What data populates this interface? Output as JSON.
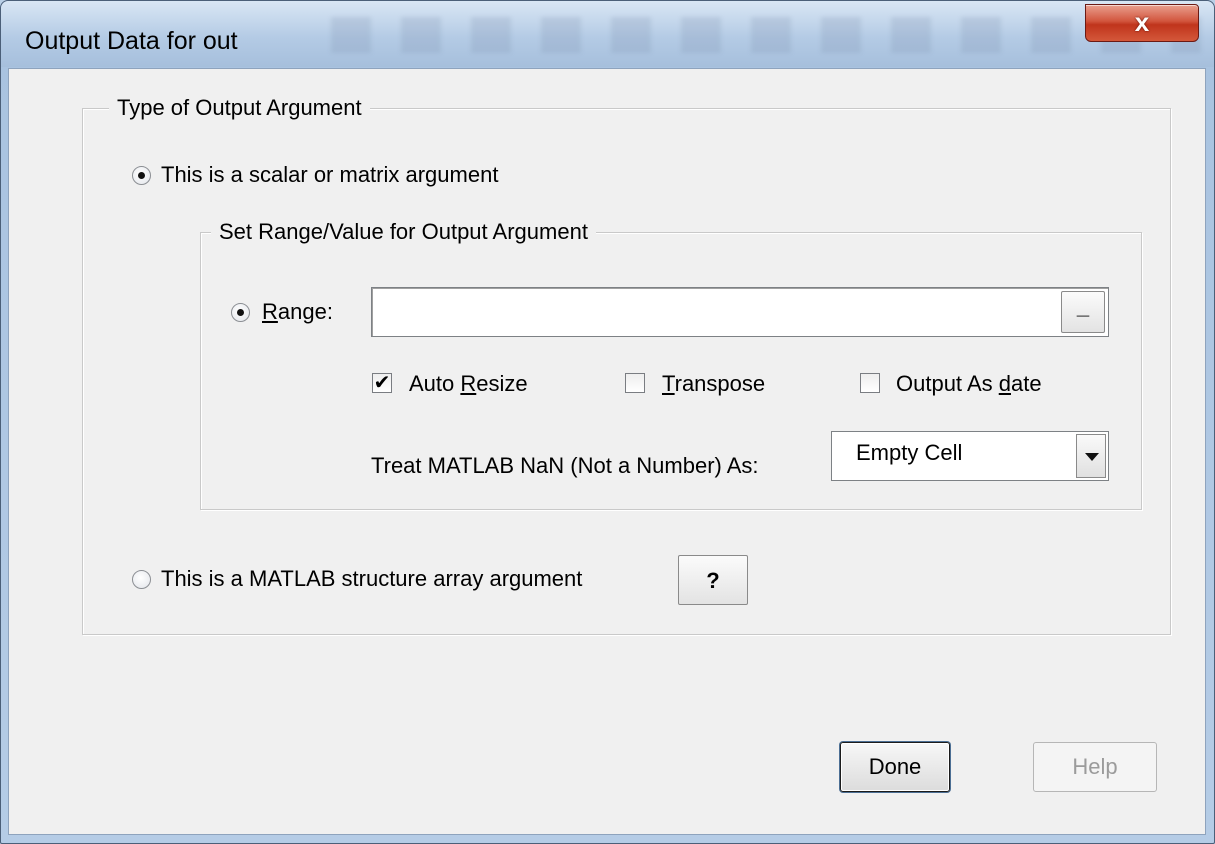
{
  "window": {
    "title": "Output Data for out",
    "close_glyph": "x"
  },
  "type_group": {
    "legend": "Type of Output Argument",
    "scalar_option": {
      "label": "This is a scalar or matrix argument",
      "checked": true
    },
    "struct_option": {
      "label": "This is a MATLAB structure array argument",
      "checked": false
    },
    "help_question_label": "?"
  },
  "range_group": {
    "legend": "Set Range/Value for Output Argument",
    "range_option": {
      "pre": "",
      "accel": "R",
      "post": "ange:",
      "checked": true
    },
    "range_value": "",
    "range_picker_label": "_",
    "auto_resize": {
      "pre": "Auto ",
      "accel": "R",
      "post": "esize",
      "checked": true
    },
    "transpose": {
      "pre": "",
      "accel": "T",
      "post": "ranspose",
      "checked": false
    },
    "output_as_date": {
      "pre": "Output As ",
      "accel": "d",
      "post": "ate",
      "checked": false
    },
    "nan_label": "Treat MATLAB NaN (Not a Number) As:",
    "nan_select_value": "Empty Cell",
    "check_mark": "✔"
  },
  "buttons": {
    "done": "Done",
    "help": "Help"
  },
  "colors": {
    "dialog_bg": "#f0f0f0",
    "close_button": "#c7401f",
    "disabled_text": "#9b9b9b"
  }
}
